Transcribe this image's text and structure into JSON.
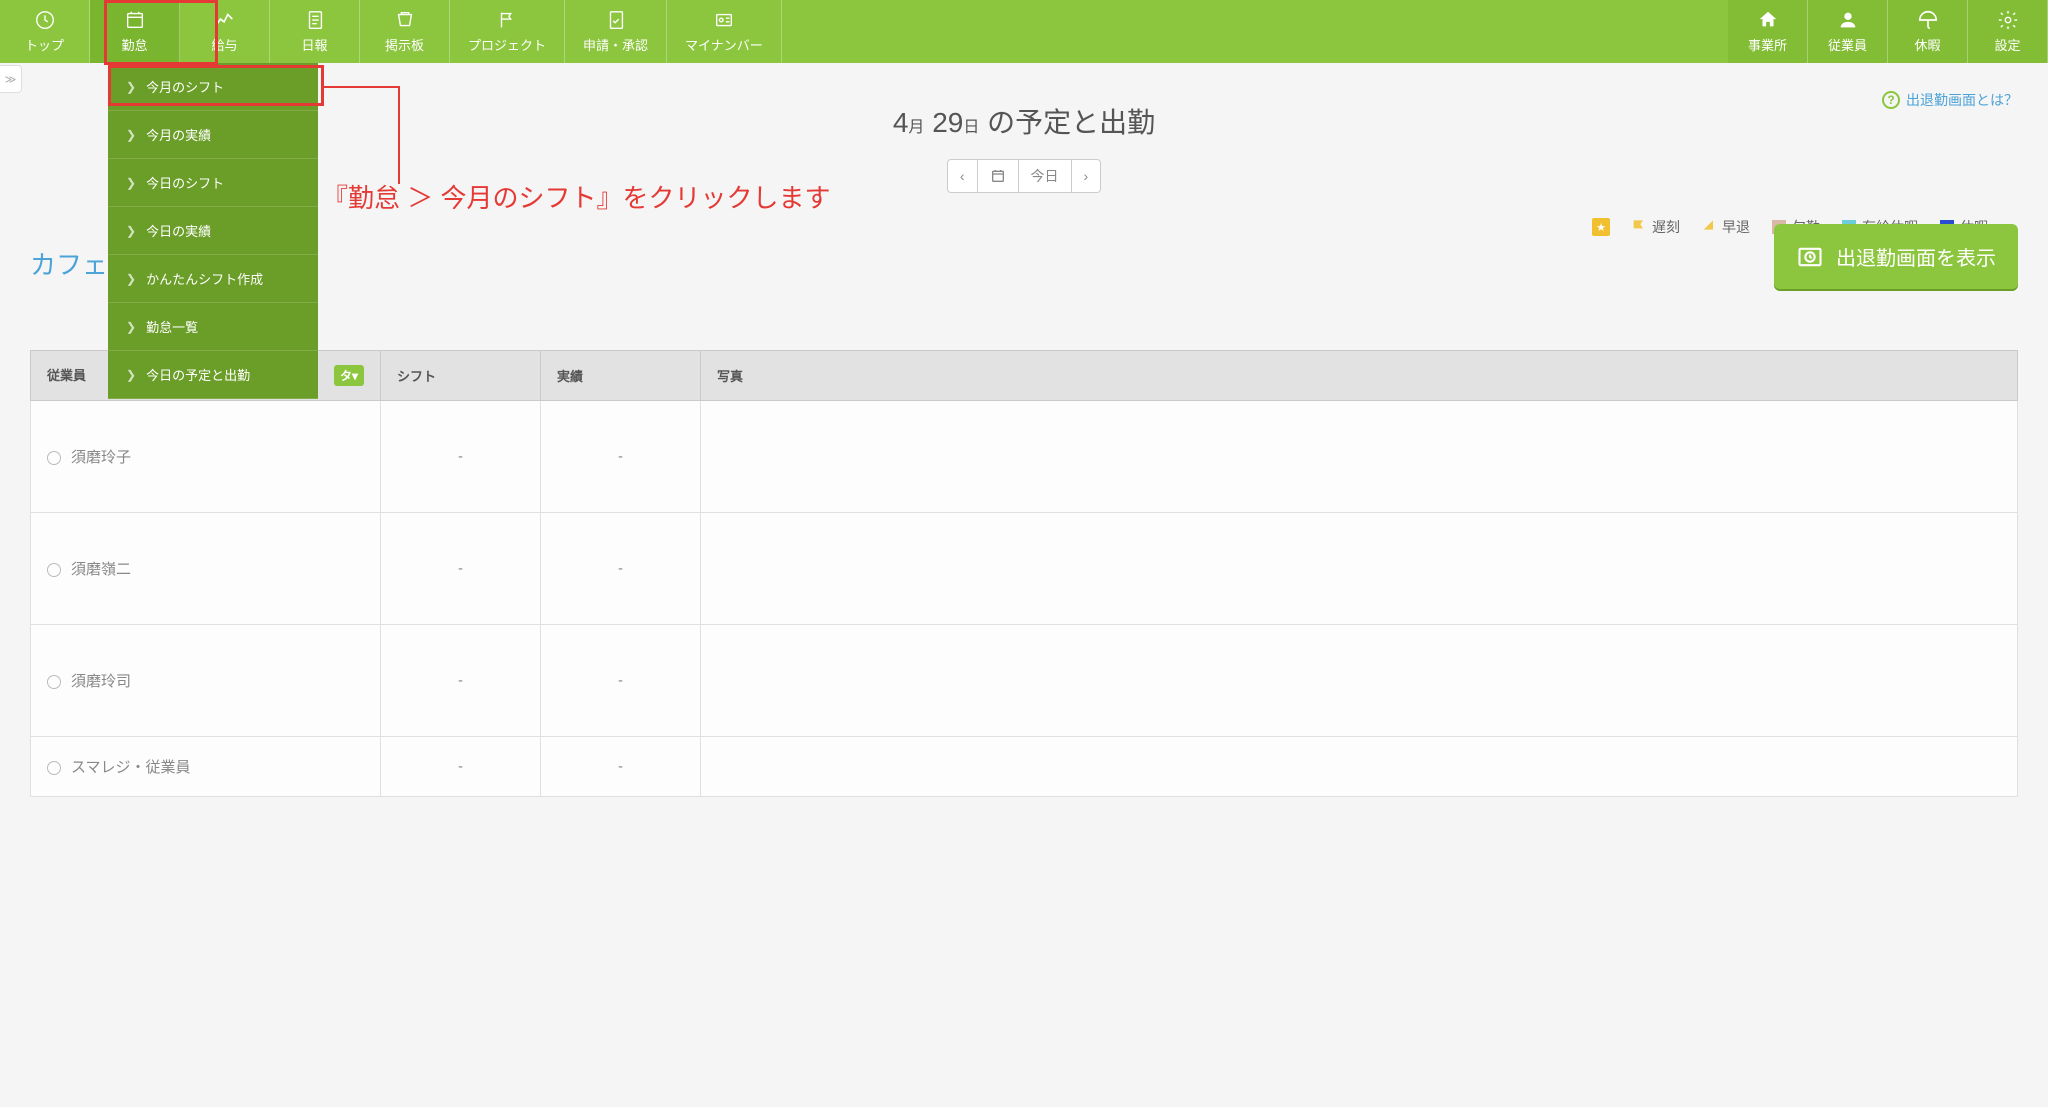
{
  "nav": {
    "left": [
      {
        "label": "トップ",
        "icon": "clock-icon"
      },
      {
        "label": "勤怠",
        "icon": "calendar-icon",
        "active": true
      },
      {
        "label": "給与",
        "icon": "chart-icon"
      },
      {
        "label": "日報",
        "icon": "document-icon"
      },
      {
        "label": "掲示板",
        "icon": "board-icon"
      },
      {
        "label": "プロジェクト",
        "icon": "flag-icon"
      },
      {
        "label": "申請・承認",
        "icon": "approval-icon"
      },
      {
        "label": "マイナンバー",
        "icon": "id-icon"
      }
    ],
    "right": [
      {
        "label": "事業所",
        "icon": "home-icon"
      },
      {
        "label": "従業員",
        "icon": "person-icon"
      },
      {
        "label": "休暇",
        "icon": "umbrella-icon"
      },
      {
        "label": "設定",
        "icon": "gear-icon"
      }
    ]
  },
  "dropdown": [
    "今月のシフト",
    "今月の実績",
    "今日のシフト",
    "今日の実績",
    "かんたんシフト作成",
    "勤怠一覧",
    "今日の予定と出勤"
  ],
  "instruction": "『勤怠 ＞ 今月のシフト』をクリックします",
  "title": {
    "month": "4",
    "month_suffix": "月",
    "day": "29",
    "day_suffix": "日",
    "rest": " の予定と出勤"
  },
  "help_link": "出退勤画面とは？",
  "date_nav": {
    "today": "今日"
  },
  "legend": {
    "late": "遅刻",
    "early": "早退",
    "absent": "欠勤",
    "paid": "有給休暇",
    "holiday": "休暇"
  },
  "shop_title": "カフェ",
  "show_button": "出退勤画面を表示",
  "table": {
    "headers": [
      "従業員",
      "シフト",
      "実績",
      "写真"
    ],
    "filter_suffix": "タ",
    "rows": [
      {
        "name": "須磨玲子",
        "shift": "-",
        "actual": "-"
      },
      {
        "name": "須磨嶺二",
        "shift": "-",
        "actual": "-"
      },
      {
        "name": "須磨玲司",
        "shift": "-",
        "actual": "-"
      },
      {
        "name": "スマレジ・従業員",
        "shift": "-",
        "actual": "-"
      }
    ]
  }
}
